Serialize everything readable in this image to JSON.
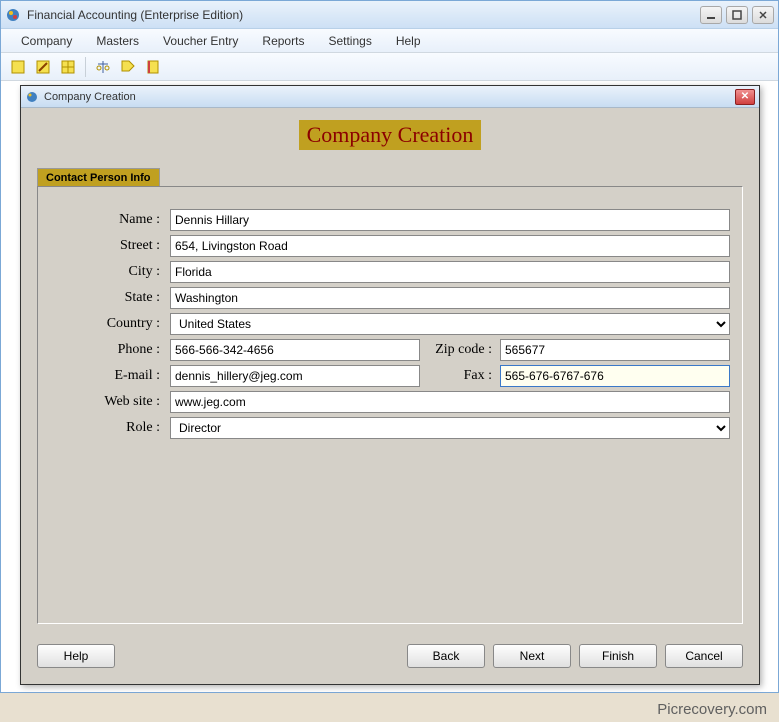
{
  "app": {
    "title": "Financial Accounting (Enterprise Edition)"
  },
  "menus": [
    "Company",
    "Masters",
    "Voucher Entry",
    "Reports",
    "Settings",
    "Help"
  ],
  "dialog": {
    "title": "Company Creation",
    "heading": "Company Creation",
    "section": "Contact Person Info",
    "labels": {
      "name": "Name :",
      "street": "Street :",
      "city": "City :",
      "state": "State :",
      "country": "Country :",
      "phone": "Phone :",
      "email": "E-mail :",
      "website": "Web site :",
      "role": "Role :",
      "zip": "Zip code :",
      "fax": "Fax :"
    },
    "fields": {
      "name": "Dennis Hillary",
      "street": "654, Livingston Road",
      "city": "Florida",
      "state": "Washington",
      "country": "United States",
      "phone": "566-566-342-4656",
      "zip": "565677",
      "email": "dennis_hillery@jeg.com",
      "fax": "565-676-6767-676",
      "website": "www.jeg.com",
      "role": "Director"
    },
    "buttons": {
      "help": "Help",
      "back": "Back",
      "next": "Next",
      "finish": "Finish",
      "cancel": "Cancel"
    }
  },
  "watermark": "Picrecovery.com"
}
